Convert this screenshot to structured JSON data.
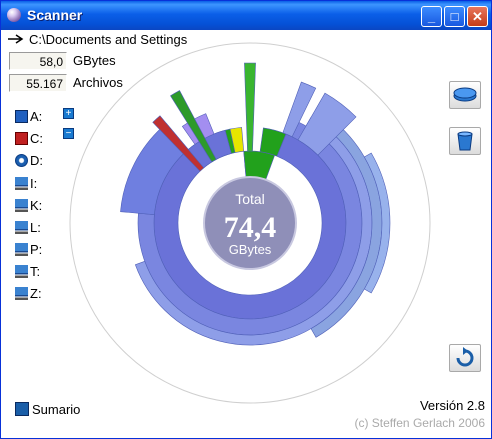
{
  "window": {
    "title": "Scanner",
    "buttons": {
      "minimize": "_",
      "maximize": "□",
      "close": "✕"
    }
  },
  "path": "C:\\Documents and Settings",
  "stats": [
    {
      "value": "58,0",
      "label": "GBytes"
    },
    {
      "value": "55.167",
      "label": "Archivos"
    }
  ],
  "drives": [
    {
      "label": "A:",
      "icon": "floppy-icon"
    },
    {
      "label": "C:",
      "icon": "hard-drive-red-icon"
    },
    {
      "label": "D:",
      "icon": "cd-drive-icon"
    },
    {
      "label": "I:",
      "icon": "network-drive-icon"
    },
    {
      "label": "K:",
      "icon": "network-drive-icon"
    },
    {
      "label": "L:",
      "icon": "network-drive-icon"
    },
    {
      "label": "P:",
      "icon": "network-drive-icon"
    },
    {
      "label": "T:",
      "icon": "network-drive-icon"
    },
    {
      "label": "Z:",
      "icon": "network-drive-icon"
    }
  ],
  "zoom": {
    "in": "+",
    "out": "−"
  },
  "center": {
    "caption": "Total",
    "value": "74,4",
    "unit": "GBytes"
  },
  "summary_label": "Sumario",
  "version": "Versión 2.8",
  "copyright": "(c) Steffen Gerlach 2006",
  "colors": {
    "ring_outer": "#8e9ee8",
    "ring_mid": "#6a72d8",
    "ring_inner": "#3c3d93",
    "center": "#8f8fb8",
    "green": "#22a11c",
    "yellow": "#e6e600"
  }
}
